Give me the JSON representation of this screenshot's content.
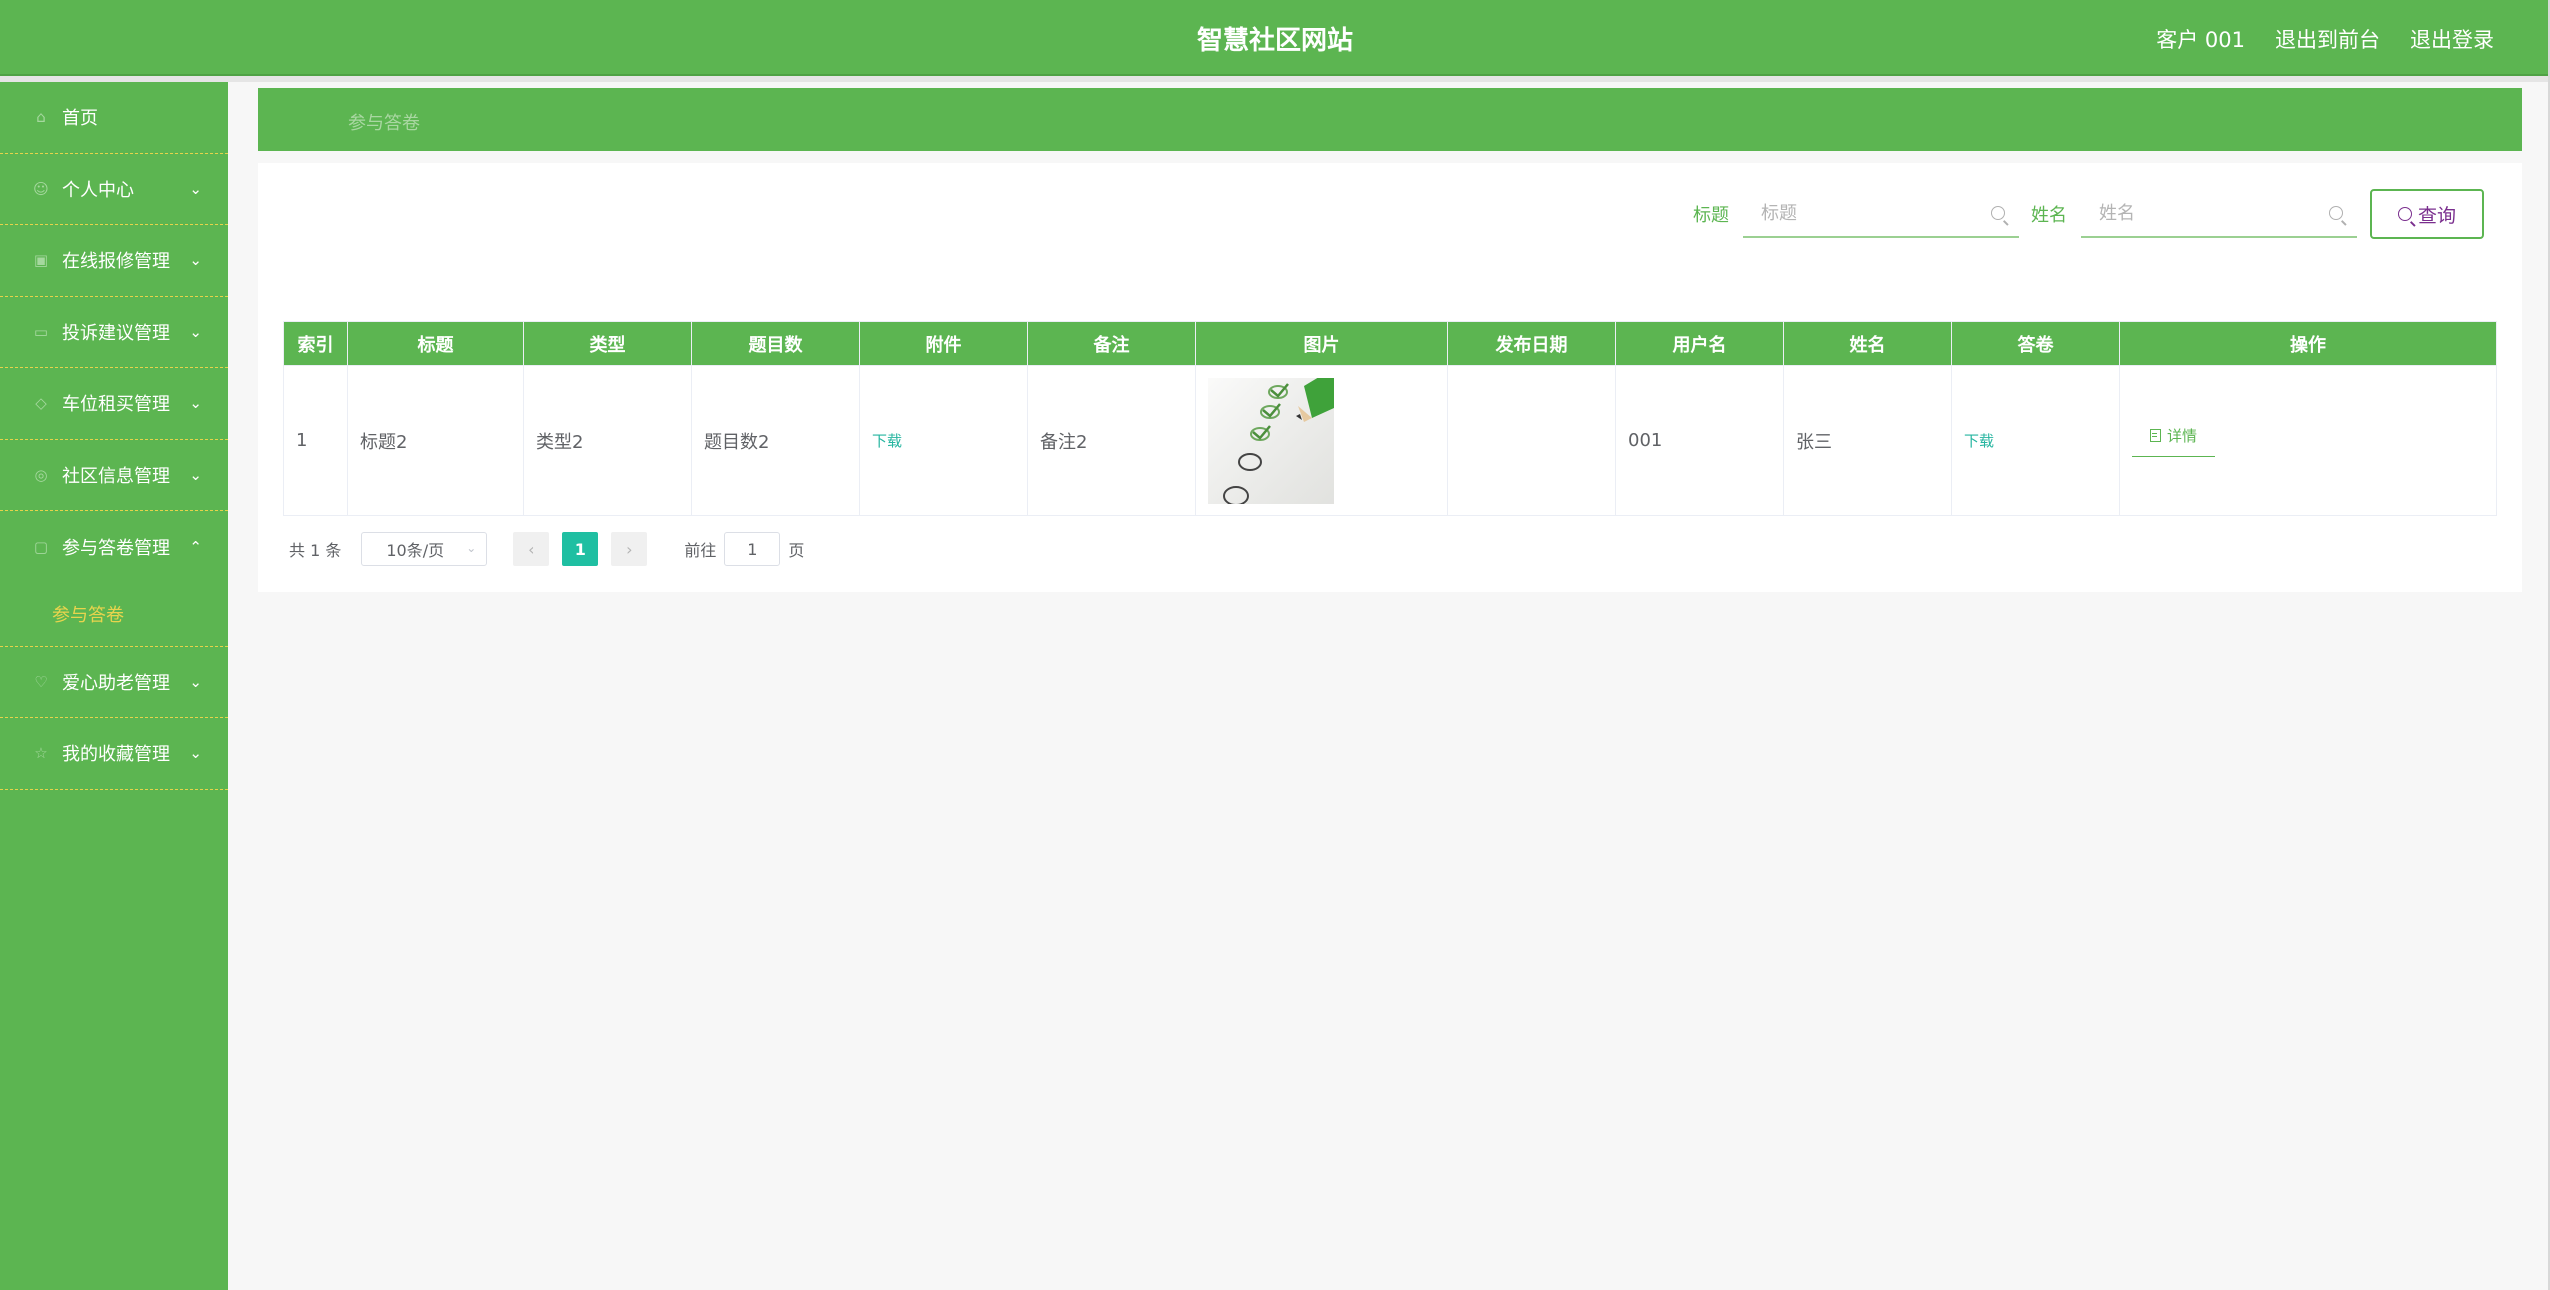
{
  "header": {
    "title": "智慧社区网站",
    "nav": [
      "客户 001",
      "退出到前台",
      "退出登录"
    ]
  },
  "sidebar": {
    "items": [
      {
        "label": "首页",
        "icon": "home-icon",
        "expandable": false
      },
      {
        "label": "个人中心",
        "icon": "user-icon",
        "expandable": true
      },
      {
        "label": "在线报修管理",
        "icon": "tool-icon",
        "expandable": true
      },
      {
        "label": "投诉建议管理",
        "icon": "message-icon",
        "expandable": true
      },
      {
        "label": "车位租买管理",
        "icon": "car-icon",
        "expandable": true
      },
      {
        "label": "社区信息管理",
        "icon": "info-icon",
        "expandable": true
      },
      {
        "label": "参与答卷管理",
        "icon": "form-icon",
        "expandable": true,
        "open": true,
        "children": [
          {
            "label": "参与答卷"
          }
        ]
      },
      {
        "label": "爱心助老管理",
        "icon": "heart-icon",
        "expandable": true
      },
      {
        "label": "我的收藏管理",
        "icon": "star-icon",
        "expandable": true
      }
    ]
  },
  "breadcrumb": {
    "current": "参与答卷"
  },
  "search": {
    "title_label": "标题",
    "title_placeholder": "标题",
    "name_label": "姓名",
    "name_placeholder": "姓名",
    "button_label": "查询"
  },
  "table": {
    "headers": [
      "索引",
      "标题",
      "类型",
      "题目数",
      "附件",
      "备注",
      "图片",
      "发布日期",
      "用户名",
      "姓名",
      "答卷",
      "操作"
    ],
    "rows": [
      {
        "index": "1",
        "title": "标题2",
        "type": "类型2",
        "question_count": "题目数2",
        "attachment": "下载",
        "remark": "备注2",
        "publish_date": "",
        "username": "001",
        "name": "张三",
        "answer": "下载",
        "action": "详情"
      }
    ]
  },
  "pagination": {
    "total_text": "共 1 条",
    "page_size": "10条/页",
    "current_page": "1",
    "goto_prefix": "前往",
    "goto_value": "1",
    "goto_suffix": "页"
  },
  "colors": {
    "primary": "#5cb551",
    "accent_yellow": "#e8d44d",
    "page_active": "#1fbfa2",
    "query_text": "#7a2e8e"
  }
}
